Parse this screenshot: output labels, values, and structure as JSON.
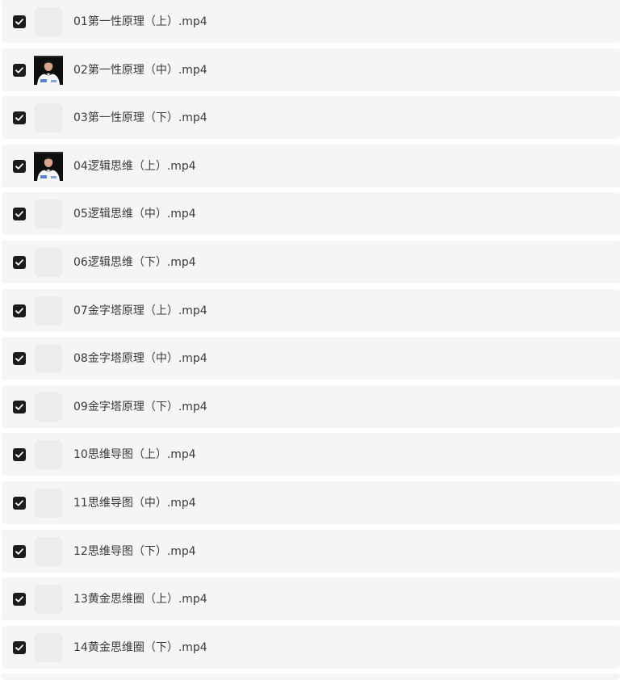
{
  "files": [
    {
      "name": "01第一性原理（上）.mp4",
      "checked": true,
      "thumbnail": "placeholder"
    },
    {
      "name": "02第一性原理（中）.mp4",
      "checked": true,
      "thumbnail": "speaker-photo"
    },
    {
      "name": "03第一性原理（下）.mp4",
      "checked": true,
      "thumbnail": "placeholder"
    },
    {
      "name": "04逻辑思维（上）.mp4",
      "checked": true,
      "thumbnail": "speaker-photo"
    },
    {
      "name": "05逻辑思维（中）.mp4",
      "checked": true,
      "thumbnail": "placeholder"
    },
    {
      "name": "06逻辑思维（下）.mp4",
      "checked": true,
      "thumbnail": "placeholder"
    },
    {
      "name": "07金字塔原理（上）.mp4",
      "checked": true,
      "thumbnail": "placeholder"
    },
    {
      "name": "08金字塔原理（中）.mp4",
      "checked": true,
      "thumbnail": "placeholder"
    },
    {
      "name": "09金字塔原理（下）.mp4",
      "checked": true,
      "thumbnail": "placeholder"
    },
    {
      "name": "10思维导图（上）.mp4",
      "checked": true,
      "thumbnail": "placeholder"
    },
    {
      "name": "11思维导图（中）.mp4",
      "checked": true,
      "thumbnail": "placeholder"
    },
    {
      "name": "12思维导图（下）.mp4",
      "checked": true,
      "thumbnail": "placeholder"
    },
    {
      "name": "13黄金思维圈（上）.mp4",
      "checked": true,
      "thumbnail": "placeholder"
    },
    {
      "name": "14黄金思维圈（下）.mp4",
      "checked": true,
      "thumbnail": "placeholder"
    }
  ],
  "colors": {
    "row_background": "#f5f5f6",
    "checkbox_fill": "#1c1c1e",
    "placeholder_thumb": "#ececed",
    "text": "#3a3a3c"
  }
}
